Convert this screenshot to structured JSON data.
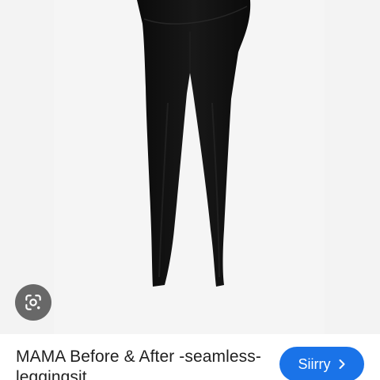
{
  "product": {
    "title": "MAMA Before & After -seamless-leggingsit",
    "image_alt": "MAMA Before & After -seamless-leggingsit"
  },
  "actions": {
    "visit_label": "Siirry",
    "visit_icon": "chevron-right-icon",
    "lens_icon": "google-lens-icon"
  },
  "colors": {
    "accent": "#1a73e8",
    "image_background": "#f3f3f3",
    "garment": "#111111"
  }
}
